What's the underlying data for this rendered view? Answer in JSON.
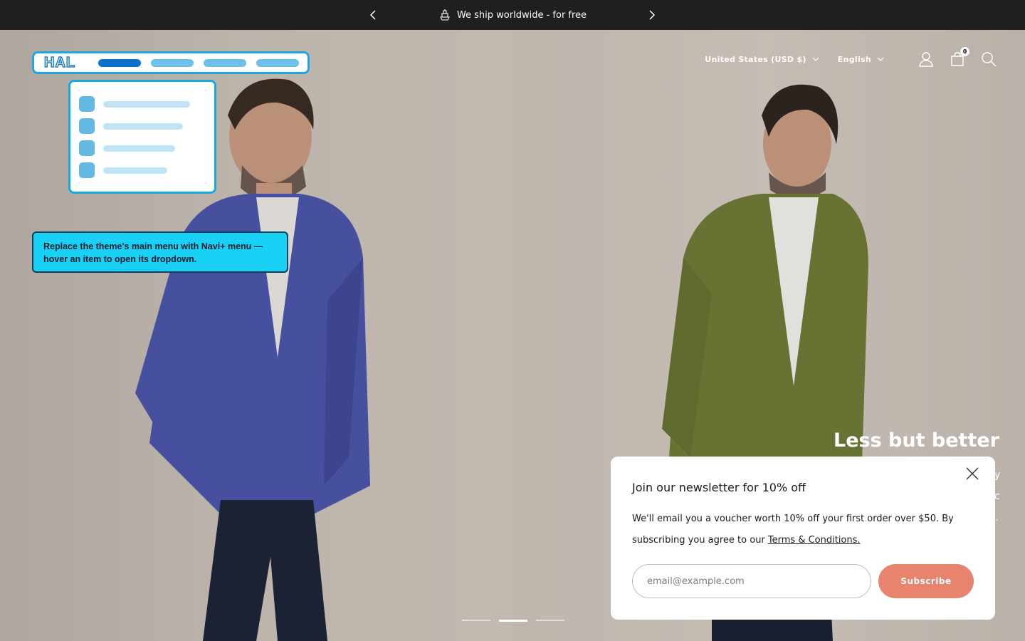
{
  "announcement": {
    "message": "We ship worldwide - for free",
    "icons": {
      "prev": "chevron-left-icon",
      "next": "chevron-right-icon",
      "ship": "ship-icon"
    }
  },
  "header": {
    "country_selector": "United States (USD $)",
    "language_selector": "English",
    "cart_count": "0",
    "icons": [
      "account-icon",
      "cart-icon",
      "search-icon"
    ]
  },
  "navi_overlay": {
    "logo": "HAL",
    "menu_pill_count": 4,
    "dropdown_item_count": 4,
    "tip_text": "Replace the theme's main menu with Navi+ menu — hover an item to open its dropdown.",
    "colors": {
      "border": "#1aa8e0",
      "active": "#0a71c8",
      "pill": "#6ec0ea",
      "tip_bg": "#19d0f5"
    }
  },
  "hero": {
    "slide_title": "Less but better",
    "peek_fragments": [
      "y",
      "c",
      "s."
    ],
    "slide_count": 3,
    "active_slide": 2
  },
  "newsletter": {
    "title": "Join our newsletter for 10% off",
    "body": "We'll email you a voucher worth 10% off your first order over $50. By subscribing you agree to our ",
    "terms_link": "Terms & Conditions.",
    "email_placeholder": "email@example.com",
    "subscribe_label": "Subscribe",
    "accent_color": "#e8846e"
  }
}
